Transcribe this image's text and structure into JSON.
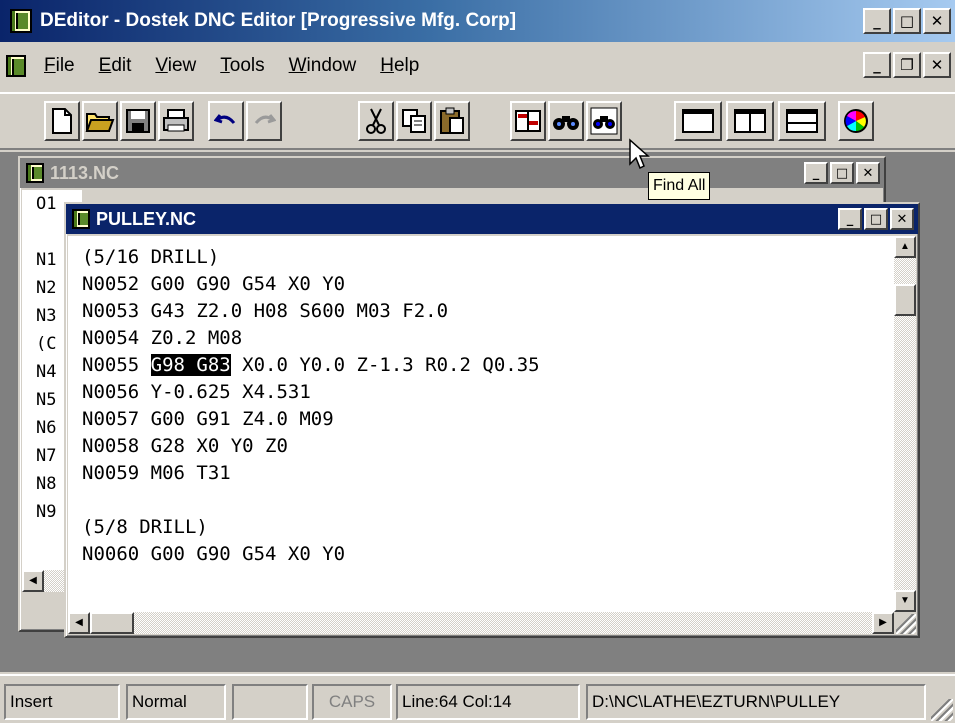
{
  "app": {
    "title": "DEditor - Dostek DNC Editor [Progressive Mfg. Corp]"
  },
  "menu": {
    "items": [
      {
        "label": "File",
        "accel": "F",
        "rest": "ile"
      },
      {
        "label": "Edit",
        "accel": "E",
        "rest": "dit"
      },
      {
        "label": "View",
        "accel": "V",
        "rest": "iew"
      },
      {
        "label": "Tools",
        "accel": "T",
        "rest": "ools"
      },
      {
        "label": "Window",
        "accel": "W",
        "rest": "indow"
      },
      {
        "label": "Help",
        "accel": "H",
        "rest": "elp"
      }
    ]
  },
  "toolbar": {
    "buttons": [
      "new-icon",
      "open-icon",
      "save-icon",
      "print-icon",
      "undo-icon",
      "redo-icon",
      "cut-icon",
      "copy-icon",
      "paste-icon",
      "compare-icon",
      "find-icon",
      "find-all-icon",
      "single-view-icon",
      "split-vertical-icon",
      "split-horizontal-icon",
      "color-icon"
    ],
    "tooltip": "Find All"
  },
  "windows": {
    "back": {
      "title": "1113.NC",
      "visible_lines": [
        "O1",
        "",
        "N1",
        "N2",
        "N3",
        "(C",
        "N4",
        "N5",
        "N6",
        "N7",
        "N8",
        "N9"
      ]
    },
    "front": {
      "title": "PULLEY.NC",
      "lines": [
        "(5/16 DRILL)",
        "N0052 G00 G90 G54 X0 Y0",
        "N0053 G43 Z2.0 H08 S600 M03 F2.0",
        "N0054 Z0.2 M08",
        "N0055 G98 G83 X0.0 Y0.0 Z-1.3 R0.2 Q0.35",
        "N0056 Y-0.625 X4.531",
        "N0057 G00 G91 Z4.0 M09",
        "N0058 G28 X0 Y0 Z0",
        "N0059 M06 T31",
        "",
        "(5/8 DRILL)",
        "N0060 G00 G90 G54 X0 Y0"
      ],
      "selected_line_prefix": "N0055 ",
      "selected_text": "G98 G83",
      "selected_line_suffix": " X0.0 Y0.0 Z-1.3 R0.2 Q0.35"
    }
  },
  "statusbar": {
    "mode": "Insert",
    "view": "Normal",
    "blank": "",
    "caps": "CAPS",
    "position": "Line:64 Col:14",
    "path": "D:\\NC\\LATHE\\EZTURN\\PULLEY"
  },
  "colors": {
    "title_active": "#0a246a",
    "title_inactive": "#808080",
    "face": "#d4d0c8",
    "mdi_background": "#808080"
  }
}
